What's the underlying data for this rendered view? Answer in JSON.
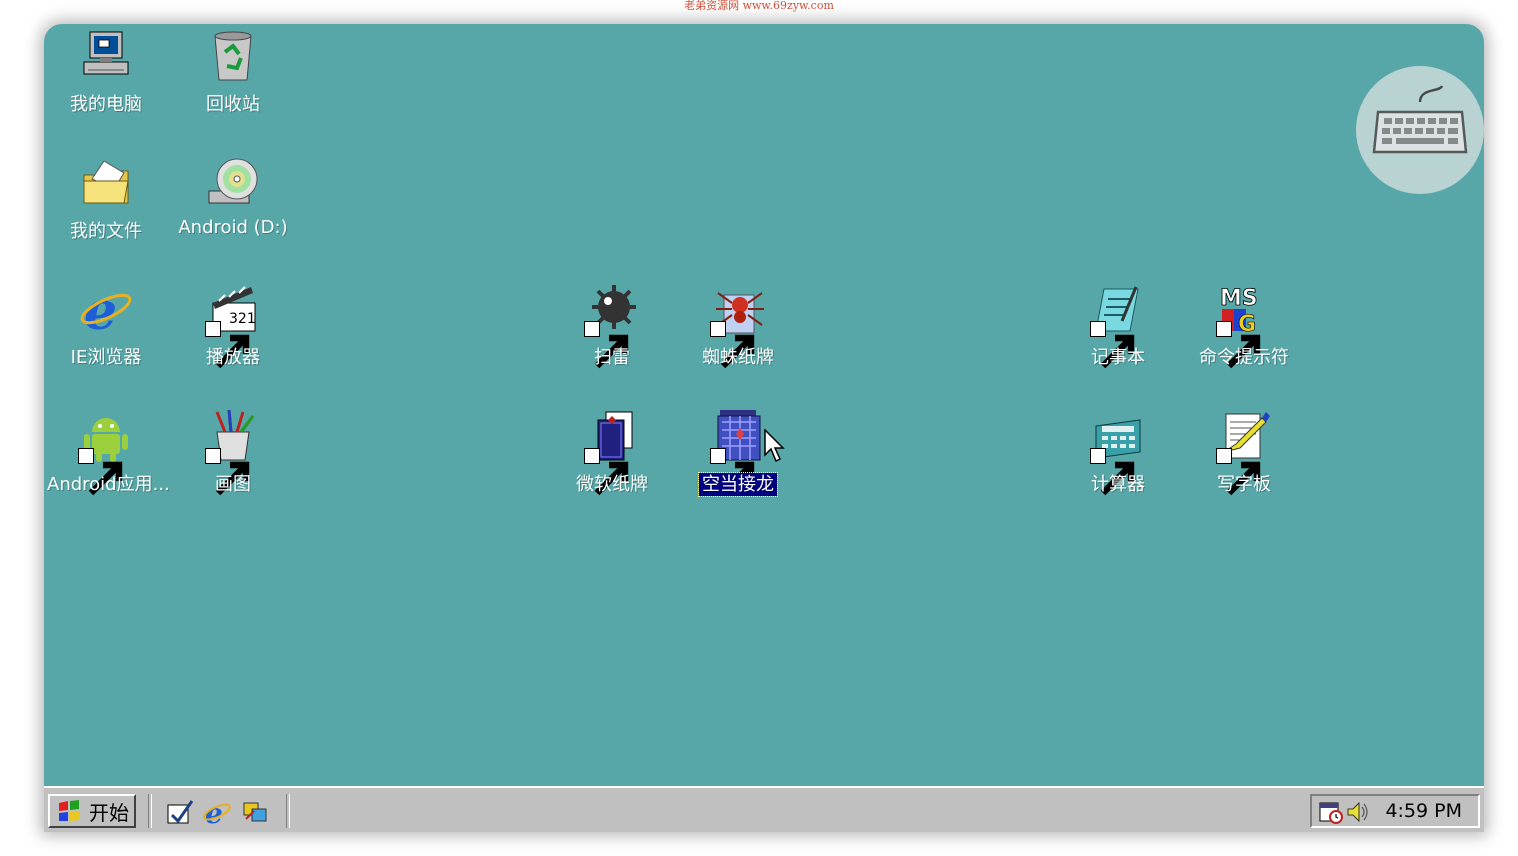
{
  "watermark": "老弟资源网 www.69zyw.com",
  "desktop": {
    "icons": {
      "my_computer": "我的电脑",
      "recycle_bin": "回收站",
      "my_documents": "我的文件",
      "android_drive": "Android (D:)",
      "ie_browser": "IE浏览器",
      "player": "播放器",
      "minesweeper": "扫雷",
      "spider_solitaire": "蜘蛛纸牌",
      "notepad": "记事本",
      "command_prompt": "命令提示符",
      "android_apps": "Android应用...",
      "paint": "画图",
      "solitaire": "微软纸牌",
      "freecell": "空当接龙",
      "calculator": "计算器",
      "wordpad": "写字板"
    },
    "selected_icon": "freecell"
  },
  "taskbar": {
    "start_label": "开始",
    "clock": "4:59 PM"
  },
  "colors": {
    "desktop": "#57a7a8",
    "taskbar": "#c0c0c0",
    "selection": "#000080"
  },
  "icons_semantic": [
    "computer-icon",
    "recycle-bin-icon",
    "folder-icon",
    "cd-drive-icon",
    "ie-icon",
    "clapperboard-icon",
    "mine-icon",
    "spider-icon",
    "notepad-icon",
    "ms-dos-icon",
    "android-icon",
    "paint-icon",
    "cards-icon",
    "freecell-icon",
    "calculator-icon",
    "wordpad-icon",
    "keyboard-icon"
  ]
}
